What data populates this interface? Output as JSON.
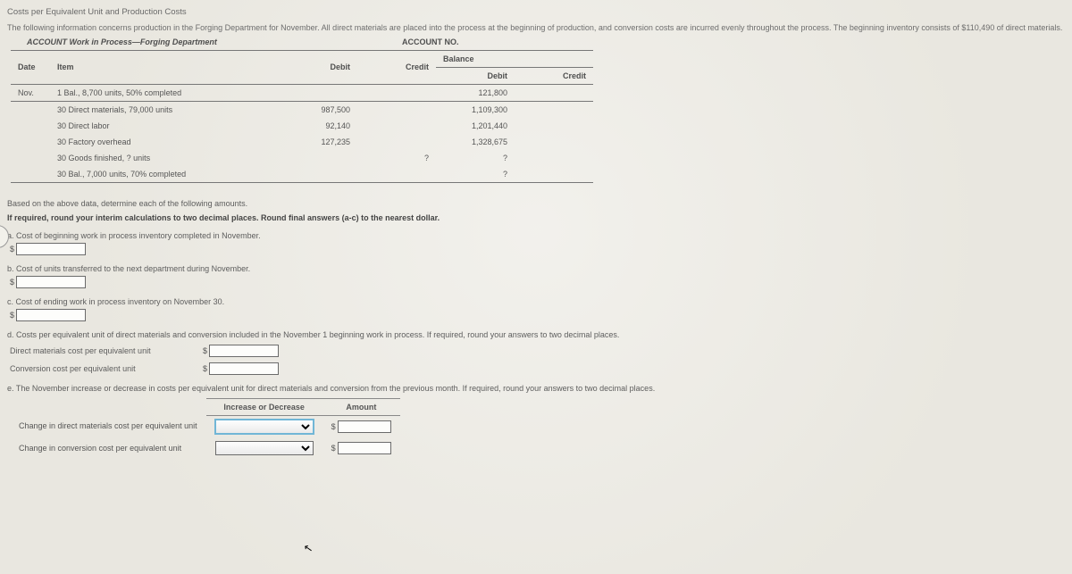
{
  "heading": "Costs per Equivalent Unit and Production Costs",
  "intro_line": "The following information concerns production in the Forging Department for November. All direct materials are placed into the process at the beginning of production, and conversion costs are incurred evenly throughout the process. The beginning inventory consists of $110,490 of direct materials.",
  "account_left": "ACCOUNT Work in Process—Forging Department",
  "account_right": "ACCOUNT NO.",
  "cols": {
    "date": "Date",
    "item": "Item",
    "debit": "Debit",
    "credit": "Credit",
    "balance": "Balance",
    "baldebit": "Debit",
    "balcredit": "Credit"
  },
  "rows": {
    "r1": {
      "date": "Nov.",
      "day": "1",
      "item": "Bal., 8,700 units, 50% completed",
      "debit": "",
      "credit": "",
      "baldebit": "121,800",
      "balcredit": ""
    },
    "r2": {
      "date": "",
      "day": "30",
      "item": "Direct materials, 79,000 units",
      "debit": "987,500",
      "credit": "",
      "baldebit": "1,109,300",
      "balcredit": ""
    },
    "r3": {
      "date": "",
      "day": "30",
      "item": "Direct labor",
      "debit": "92,140",
      "credit": "",
      "baldebit": "1,201,440",
      "balcredit": ""
    },
    "r4": {
      "date": "",
      "day": "30",
      "item": "Factory overhead",
      "debit": "127,235",
      "credit": "",
      "baldebit": "1,328,675",
      "balcredit": ""
    },
    "r5": {
      "date": "",
      "day": "30",
      "item": "Goods finished, ? units",
      "debit": "",
      "credit": "?",
      "baldebit": "?",
      "balcredit": ""
    },
    "r6": {
      "date": "",
      "day": "30",
      "item": "Bal., 7,000 units, 70% completed",
      "debit": "",
      "credit": "",
      "baldebit": "?",
      "balcredit": ""
    }
  },
  "based_on": "Based on the above data, determine each of the following amounts.",
  "rounding": "If required, round your interim calculations to two decimal places. Round final answers (a-c) to the nearest dollar.",
  "qa": {
    "a": "a.  Cost of beginning work in process inventory completed in November.",
    "b": "b.  Cost of units transferred to the next department during November.",
    "c": "c.  Cost of ending work in process inventory on November 30.",
    "d": "d.  Costs per equivalent unit of direct materials and conversion included in the November 1 beginning work in process. If required, round your answers to two decimal places.",
    "d_dm": "Direct materials cost per equivalent unit",
    "d_conv": "Conversion cost per equivalent unit",
    "e": "e.  The November increase or decrease in costs per equivalent unit for direct materials and conversion from the previous month. If required, round your answers to two decimal places."
  },
  "change_table": {
    "col1": "Increase or Decrease",
    "col2": "Amount",
    "row1": "Change in direct materials cost per equivalent unit",
    "row2": "Change in conversion cost per equivalent unit"
  },
  "currency": "$"
}
